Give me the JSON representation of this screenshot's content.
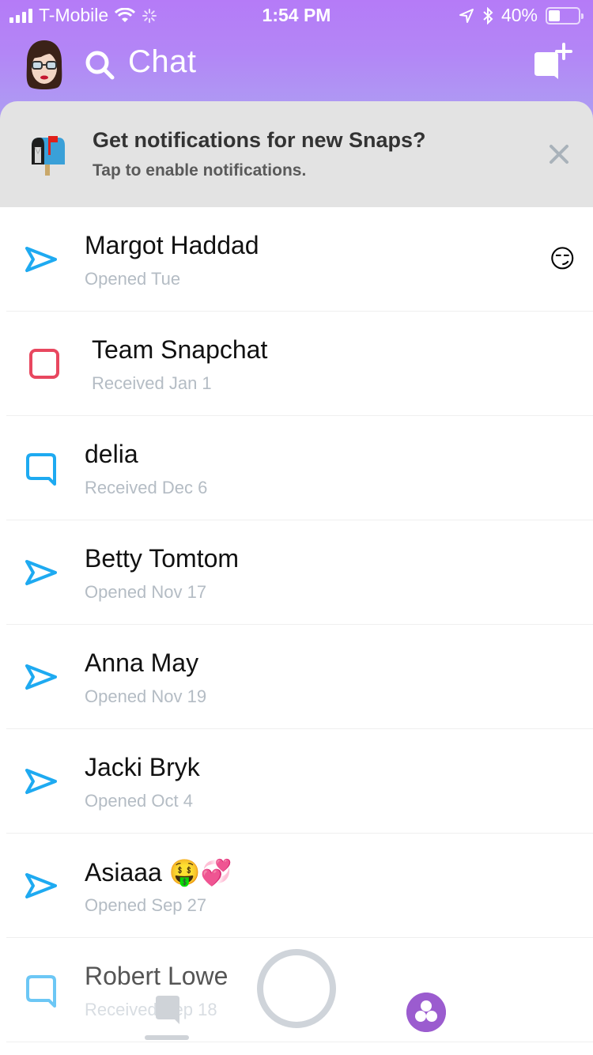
{
  "status_bar": {
    "carrier": "T-Mobile",
    "time": "1:54 PM",
    "battery_percent_label": "40%",
    "battery_level": 0.4,
    "icons": [
      "signal-icon",
      "wifi-icon",
      "activity-spinner-icon",
      "location-icon",
      "bluetooth-icon",
      "battery-icon"
    ]
  },
  "header": {
    "title": "Chat",
    "search_icon": "search-icon",
    "new_chat_icon": "new-chat-icon",
    "avatar": "bitmoji-avatar",
    "colors": {
      "gradient_top": "#b57bf7",
      "gradient_bottom": "#ad9ef2"
    }
  },
  "notification_banner": {
    "icon": "mailbox-emoji",
    "title": "Get notifications for new Snaps?",
    "subtitle": "Tap to enable notifications.",
    "close_icon": "close-icon"
  },
  "chats": [
    {
      "name": "Margot Haddad",
      "status": "Opened Tue",
      "icon": "sent-opened-arrow-icon",
      "trailing_emoji": "😏"
    },
    {
      "name": "Team Snapchat",
      "status": "Received Jan 1",
      "icon": "snap-received-square-icon"
    },
    {
      "name": "delia",
      "status": "Received Dec 6",
      "icon": "chat-received-bubble-icon"
    },
    {
      "name": "Betty Tomtom",
      "status": "Opened Nov 17",
      "icon": "sent-opened-arrow-icon"
    },
    {
      "name": "Anna May",
      "status": "Opened Nov 19",
      "icon": "sent-opened-arrow-icon"
    },
    {
      "name": "Jacki Bryk",
      "status": "Opened Oct 4",
      "icon": "sent-opened-arrow-icon"
    },
    {
      "name": "Asiaaa 🤑💞",
      "status": "Opened Sep 27",
      "icon": "sent-opened-arrow-icon"
    },
    {
      "name": "Robert Lowe",
      "status": "Received Sep 18",
      "icon": "chat-received-bubble-icon"
    }
  ],
  "bottom_nav": {
    "items": [
      "chat-tab",
      "capture-button",
      "discover-tab"
    ],
    "active": "chat-tab"
  },
  "colors": {
    "chat_blue": "#1eaaf1",
    "snap_red": "#e8475f",
    "discover_purple": "#9b5ccf",
    "status_gray": "#b4bcc4"
  }
}
